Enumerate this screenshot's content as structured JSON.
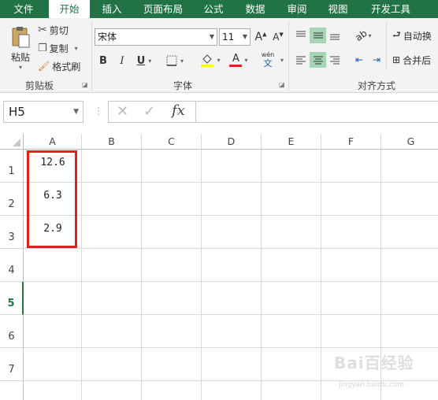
{
  "tabs": [
    "文件",
    "开始",
    "插入",
    "页面布局",
    "公式",
    "数据",
    "审阅",
    "视图",
    "开发工具"
  ],
  "active_tab": "开始",
  "ribbon": {
    "clipboard": {
      "paste_label": "粘贴",
      "cut_label": "剪切",
      "copy_label": "复制",
      "format_painter_label": "格式刷",
      "group_label": "剪贴板"
    },
    "font": {
      "font_name": "宋体",
      "font_size": "11",
      "bold": "B",
      "italic": "I",
      "underline": "U",
      "font_color_glyph": "A",
      "highlight_color": "#ffff00",
      "font_color": "#e0201f",
      "phonetic_label": "wén",
      "phonetic_char": "文",
      "group_label": "字体"
    },
    "alignment": {
      "wrap_text_label": "自动换",
      "merge_label": "合并后",
      "group_label": "对齐方式"
    }
  },
  "formula_bar": {
    "name_box": "H5",
    "fx_label": "fx",
    "formula_value": ""
  },
  "grid": {
    "columns": [
      "A",
      "B",
      "C",
      "D",
      "E",
      "F",
      "G"
    ],
    "rows": [
      "1",
      "2",
      "3",
      "4",
      "5",
      "6",
      "7"
    ],
    "active_row": "5",
    "cells": {
      "A1": "12.6",
      "A2": "6.3",
      "A3": "2.9"
    }
  },
  "watermark": {
    "text": "Bai百经验",
    "url": "jingyan.baidu.com"
  },
  "colors": {
    "accent": "#217346",
    "highlight": "#a6d5b5",
    "annotation_box": "#e01f1f"
  }
}
